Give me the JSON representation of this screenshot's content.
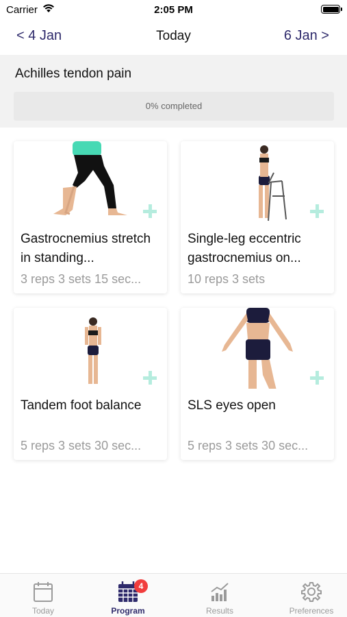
{
  "status_bar": {
    "carrier": "Carrier",
    "time": "2:05 PM"
  },
  "nav": {
    "prev_label": "< 4 Jan",
    "title": "Today",
    "next_label": "6 Jan >"
  },
  "program": {
    "name": "Achilles tendon pain",
    "progress_percent": 0,
    "progress_label": "0% completed"
  },
  "exercises": [
    {
      "title": "Gastrocnemius stretch in standing...",
      "meta": "3 reps 3 sets 15 sec..."
    },
    {
      "title": "Single-leg eccentric gastrocnemius on...",
      "meta": "10 reps 3 sets"
    },
    {
      "title": "Tandem foot balance",
      "meta": "5 reps 3 sets 30 sec..."
    },
    {
      "title": "SLS eyes open",
      "meta": "5 reps 3 sets 30 sec..."
    }
  ],
  "tabs": [
    {
      "label": "Today",
      "icon": "calendar-icon"
    },
    {
      "label": "Program",
      "icon": "calendar-grid-icon",
      "badge": "4"
    },
    {
      "label": "Results",
      "icon": "chart-icon"
    },
    {
      "label": "Preferences",
      "icon": "gear-icon"
    }
  ],
  "colors": {
    "accent": "#2e2a6b",
    "add_icon": "#b5ecde",
    "badge": "#f13d3d",
    "header_bg": "#f2f2f2"
  }
}
